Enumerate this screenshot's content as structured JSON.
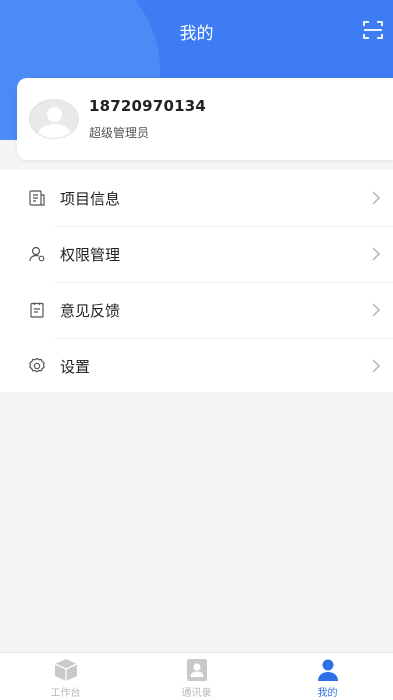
{
  "header": {
    "title": "我的"
  },
  "profile": {
    "phone": "18720970134",
    "role": "超级管理员"
  },
  "menu": {
    "items": [
      {
        "label": "项目信息",
        "icon": "document-icon"
      },
      {
        "label": "权限管理",
        "icon": "user-permission-icon"
      },
      {
        "label": "意见反馈",
        "icon": "feedback-icon"
      },
      {
        "label": "设置",
        "icon": "gear-icon"
      }
    ]
  },
  "tabbar": {
    "items": [
      {
        "label": "工作台",
        "icon": "cube-icon",
        "active": false
      },
      {
        "label": "通讯录",
        "icon": "contacts-icon",
        "active": false
      },
      {
        "label": "我的",
        "icon": "person-icon",
        "active": true
      }
    ]
  },
  "colors": {
    "primary": "#3d7cf3",
    "active_tab": "#2f6fe6",
    "inactive_tab": "#b7b7b7"
  }
}
